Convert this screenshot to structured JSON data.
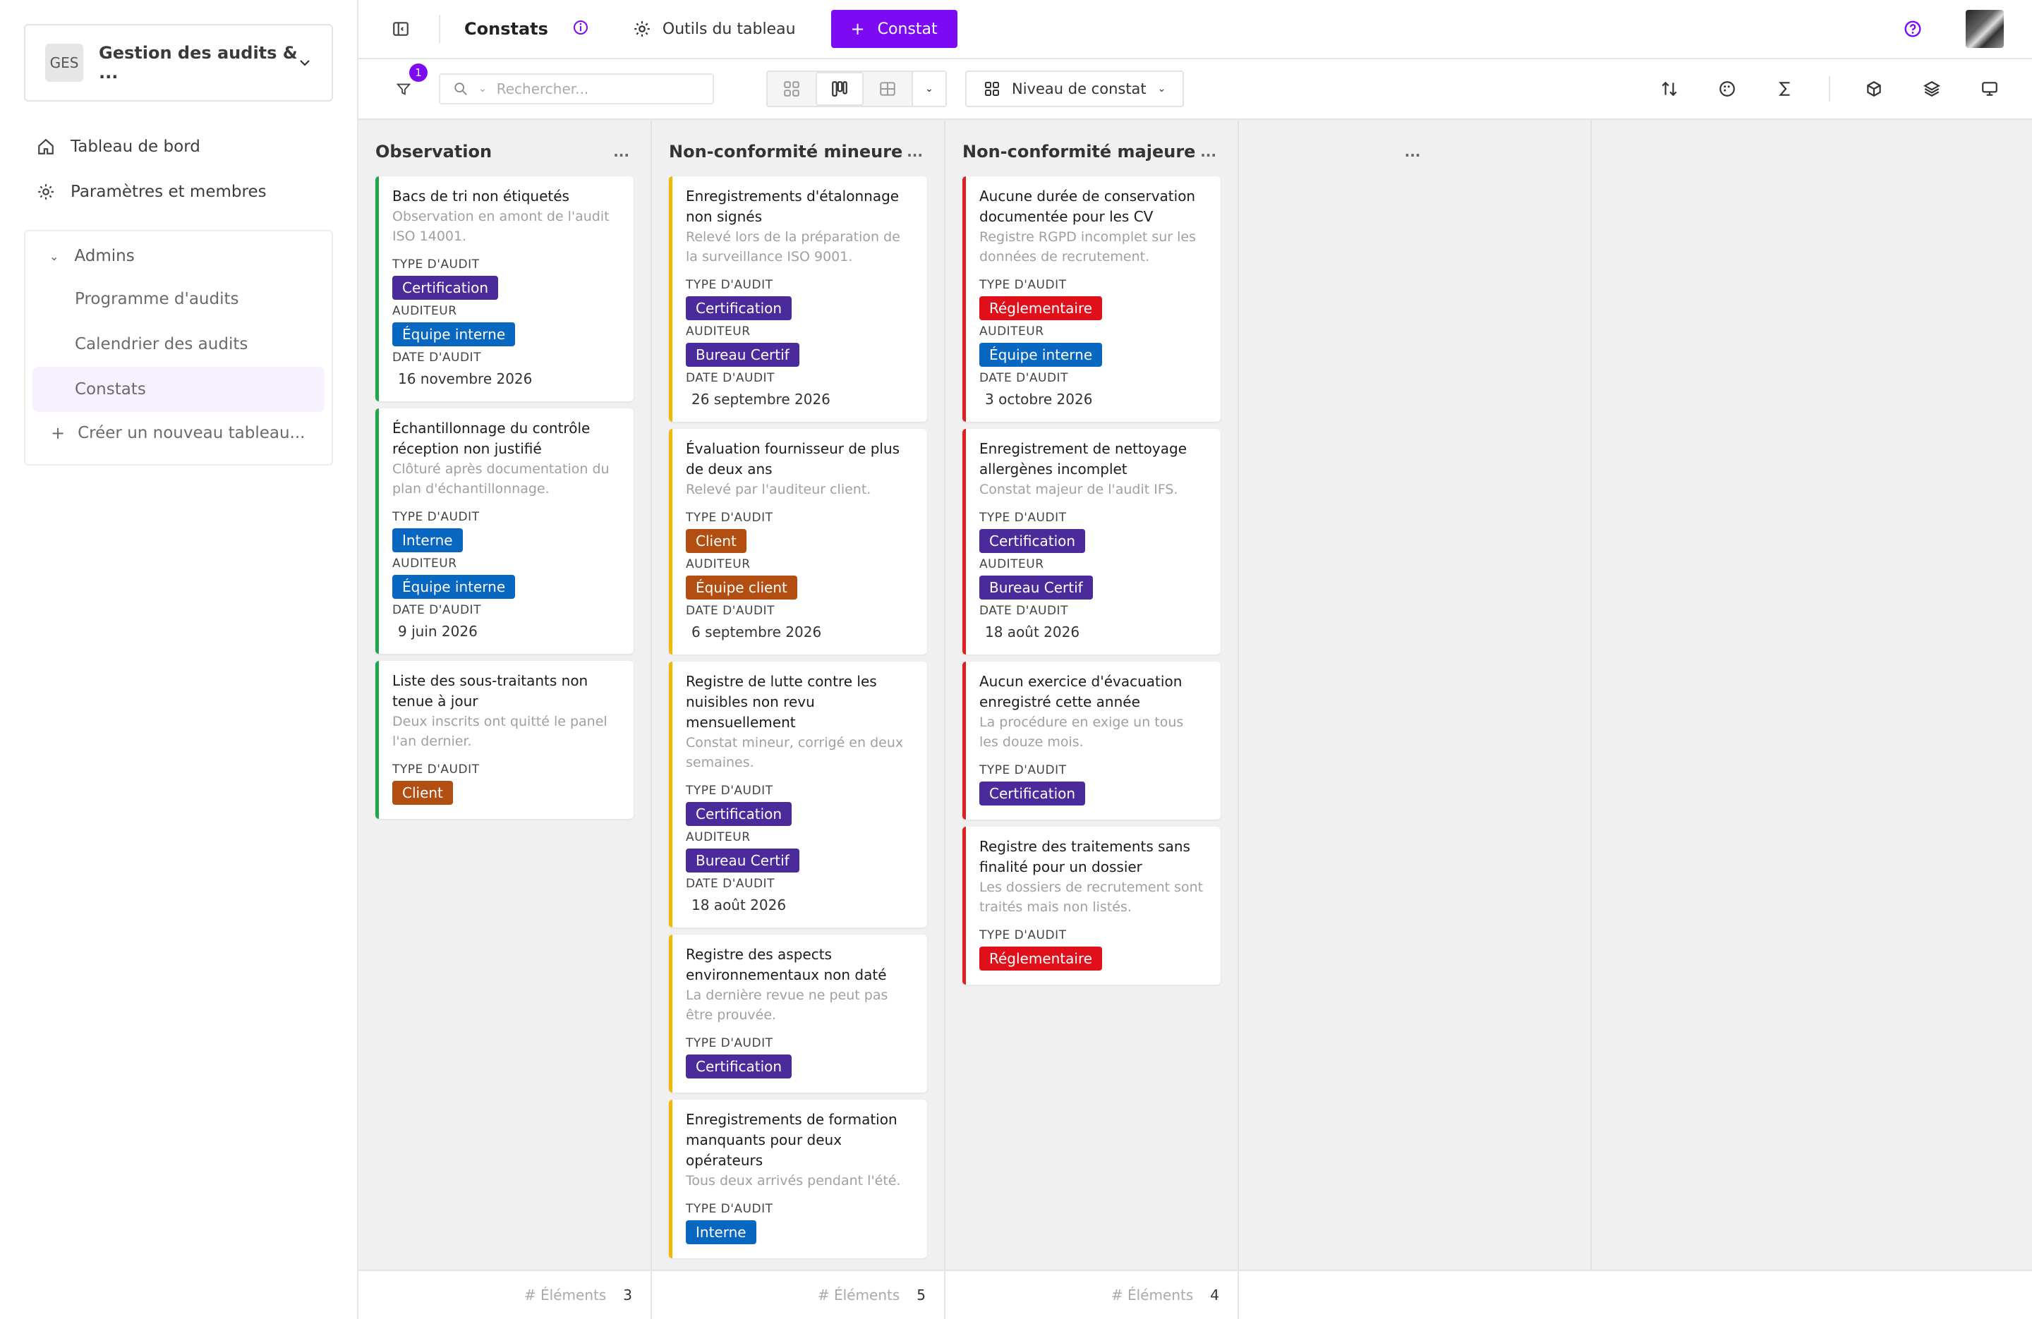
{
  "workspace": {
    "badge": "GES",
    "name": "Gestion des audits & ..."
  },
  "nav": [
    {
      "label": "Tableau de bord",
      "icon": "home-icon"
    },
    {
      "label": "Paramètres et membres",
      "icon": "gear-icon"
    }
  ],
  "group": {
    "label": "Admins",
    "items": [
      "Programme d'audits",
      "Calendrier des audits",
      "Constats"
    ],
    "active_index": 2,
    "create_label": "Créer un nouveau tableau..."
  },
  "topbar": {
    "title": "Constats",
    "tools_label": "Outils du tableau",
    "primary_label": "Constat"
  },
  "toolbar": {
    "filter_count": "1",
    "search_placeholder": "Rechercher...",
    "group_by_label": "Niveau de constat"
  },
  "colors": {
    "accent": "#7c0bf3",
    "observation": "#1fa64a",
    "mineure": "#f5b800",
    "majeure": "#e02020",
    "tag_certification": "#4b2a9c",
    "tag_interne": "#0867c0",
    "tag_client": "#b34e12",
    "tag_reglementaire": "#e0101a"
  },
  "labels": {
    "type": "TYPE D'AUDIT",
    "auditor": "AUDITEUR",
    "date": "DATE D'AUDIT"
  },
  "columns": [
    {
      "title": "Observation",
      "count": "3",
      "cards": [
        {
          "title": "Bacs de tri non étiquetés",
          "desc": "Observation en amont de l'audit ISO 14001.",
          "type": "Certification",
          "auditor": "Équipe interne",
          "date": "16 novembre 2026"
        },
        {
          "title": "Échantillonnage du contrôle réception non justifié",
          "desc": "Clôturé après documentation du plan d'échantillonnage.",
          "type": "Interne",
          "auditor": "Équipe interne",
          "date": "9 juin 2026"
        },
        {
          "title": "Liste des sous-traitants non tenue à jour",
          "desc": "Deux inscrits ont quitté le panel l'an dernier.",
          "type": "Client"
        }
      ]
    },
    {
      "title": "Non-conformité mineure",
      "count": "5",
      "cards": [
        {
          "title": "Enregistrements d'étalonnage non signés",
          "desc": "Relevé lors de la préparation de la surveillance ISO 9001.",
          "type": "Certification",
          "auditor": "Bureau Certif",
          "date": "26 septembre 2026"
        },
        {
          "title": "Évaluation fournisseur de plus de deux ans",
          "desc": "Relevé par l'auditeur client.",
          "type": "Client",
          "auditor": "Équipe client",
          "date": "6 septembre 2026"
        },
        {
          "title": "Registre de lutte contre les nuisibles non revu mensuellement",
          "desc": "Constat mineur, corrigé en deux semaines.",
          "type": "Certification",
          "auditor": "Bureau Certif",
          "date": "18 août 2026"
        },
        {
          "title": "Registre des aspects environnementaux non daté",
          "desc": "La dernière revue ne peut pas être prouvée.",
          "type": "Certification"
        },
        {
          "title": "Enregistrements de formation manquants pour deux opérateurs",
          "desc": "Tous deux arrivés pendant l'été.",
          "type": "Interne"
        }
      ]
    },
    {
      "title": "Non-conformité majeure",
      "count": "4",
      "cards": [
        {
          "title": "Aucune durée de conservation documentée pour les CV",
          "desc": "Registre RGPD incomplet sur les données de recrutement.",
          "type": "Réglementaire",
          "auditor": "Équipe interne",
          "date": "3 octobre 2026"
        },
        {
          "title": "Enregistrement de nettoyage allergènes incomplet",
          "desc": "Constat majeur de l'audit IFS.",
          "type": "Certification",
          "auditor": "Bureau Certif",
          "date": "18 août 2026"
        },
        {
          "title": "Aucun exercice d'évacuation enregistré cette année",
          "desc": "La procédure en exige un tous les douze mois.",
          "type": "Certification"
        },
        {
          "title": "Registre des traitements sans finalité pour un dossier",
          "desc": "Les dossiers de recrutement sont traités mais non listés.",
          "type": "Réglementaire"
        }
      ]
    }
  ],
  "footer_label": "# Éléments",
  "more_label": "..."
}
